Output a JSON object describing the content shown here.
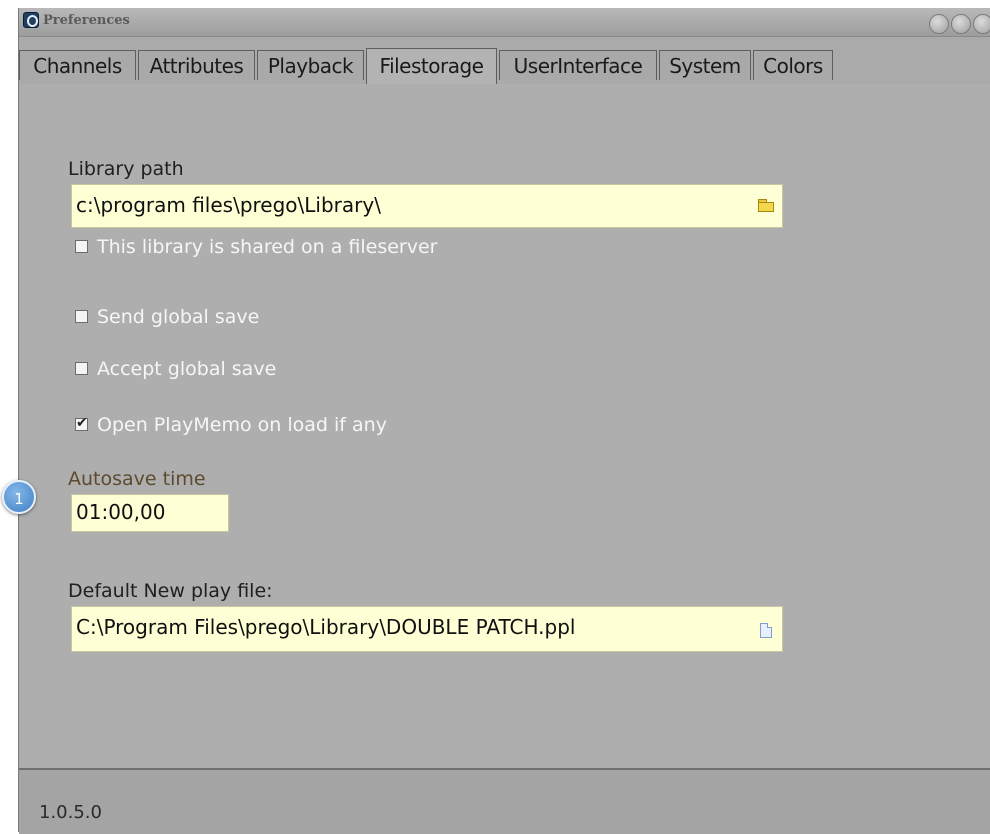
{
  "window": {
    "title": "Preferences"
  },
  "tabs": [
    {
      "label": "Channels"
    },
    {
      "label": "Attributes"
    },
    {
      "label": "Playback"
    },
    {
      "label": "Filestorage"
    },
    {
      "label": "UserInterface"
    },
    {
      "label": "System"
    },
    {
      "label": "Colors"
    }
  ],
  "active_tab": "Filestorage",
  "filestorage": {
    "library_path_label": "Library path",
    "library_path_value": "c:\\program files\\prego\\Library\\",
    "shared_checkbox_label": "This library is shared on a fileserver",
    "shared_checked": false,
    "send_global_save_label": "Send global save",
    "send_global_save_checked": false,
    "accept_global_save_label": "Accept global save",
    "accept_global_save_checked": false,
    "open_playmemo_label": "Open PlayMemo on load if any",
    "open_playmemo_checked": true,
    "autosave_label": "Autosave time",
    "autosave_value": "01:00,00",
    "default_play_label": "Default New play file:",
    "default_play_value": "C:\\Program Files\\prego\\Library\\DOUBLE PATCH.ppl"
  },
  "status": {
    "version": "1.0.5.0"
  },
  "callout": {
    "number": "1"
  },
  "icons": {
    "app": "app-logo-icon",
    "folder": "folder-icon",
    "document": "document-icon",
    "window_buttons": [
      "minimize-icon",
      "maximize-icon",
      "close-icon"
    ]
  },
  "colors": {
    "field_background": "#ffffd6",
    "window_background": "#aeaeae",
    "callout": "#3f7fc5"
  }
}
